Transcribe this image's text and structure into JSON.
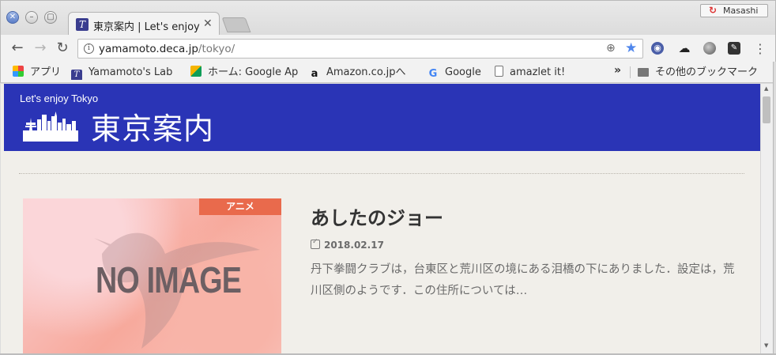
{
  "window": {
    "tab_title": "東京案内 | Let's enjoy Tokyo",
    "tab_favicon": "T",
    "profile_name": "Masashi"
  },
  "toolbar": {
    "url_host": "yamamoto.deca.jp",
    "url_path": "/tokyo/"
  },
  "bookmarks": {
    "items": [
      {
        "label": "アプリ",
        "icon": "apps-icon"
      },
      {
        "label": "Yamamoto's Lab",
        "icon": "favicon"
      },
      {
        "label": "ホーム: Google Apps",
        "icon": "google-drive-icon"
      },
      {
        "label": "Amazon.co.jpへ",
        "icon": "amazon-icon"
      },
      {
        "label": "Google",
        "icon": "google-icon"
      },
      {
        "label": "amazlet it!",
        "icon": "page-icon"
      }
    ],
    "more": "»",
    "other": "その他のブックマーク"
  },
  "site": {
    "tagline": "Let's enjoy Tokyo",
    "title": "東京案内"
  },
  "post": {
    "category": "アニメ",
    "title": "あしたのジョー",
    "date": "2018.02.17",
    "excerpt": "丹下拳闘クラブは，台東区と荒川区の境にある泪橋の下にありました．設定は，荒川区側のようです．この住所については…",
    "thumb_text": "NO IMAGE"
  },
  "colors": {
    "header_bg": "#2a34b6",
    "category_bg": "#e96a4c",
    "page_bg": "#f1efea",
    "star": "#4f86ec"
  }
}
